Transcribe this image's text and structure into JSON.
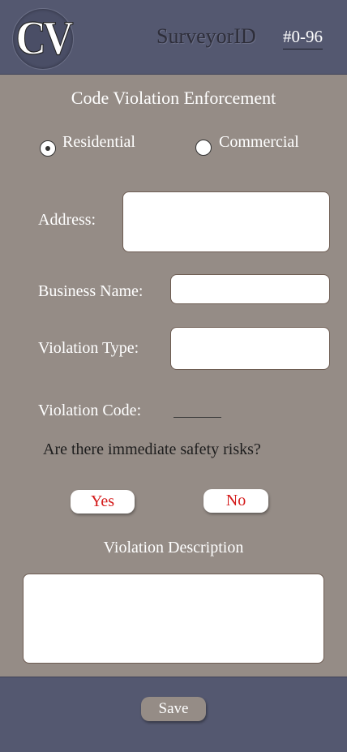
{
  "header": {
    "logo_text": "CV",
    "surveyor_label": "SurveyorID",
    "surveyor_id": "#0-96"
  },
  "form": {
    "title": "Code Violation Enforcement",
    "property_type": {
      "options": [
        {
          "label": "Residential",
          "selected": true
        },
        {
          "label": "Commercial",
          "selected": false
        }
      ]
    },
    "address_label": "Address:",
    "address_value": "",
    "business_name_label": "Business Name:",
    "business_name_value": "",
    "violation_type_label": "Violation Type:",
    "violation_type_value": "",
    "violation_code_label": "Violation Code:",
    "violation_code_value": "",
    "safety_question": "Are there immediate safety risks?",
    "yes_label": "Yes",
    "no_label": "No",
    "description_label": "Violation Description",
    "description_value": ""
  },
  "footer": {
    "save_label": "Save"
  },
  "colors": {
    "header_bg": "#545870",
    "body_bg": "#958c86",
    "accent_red": "#d41a1a"
  }
}
